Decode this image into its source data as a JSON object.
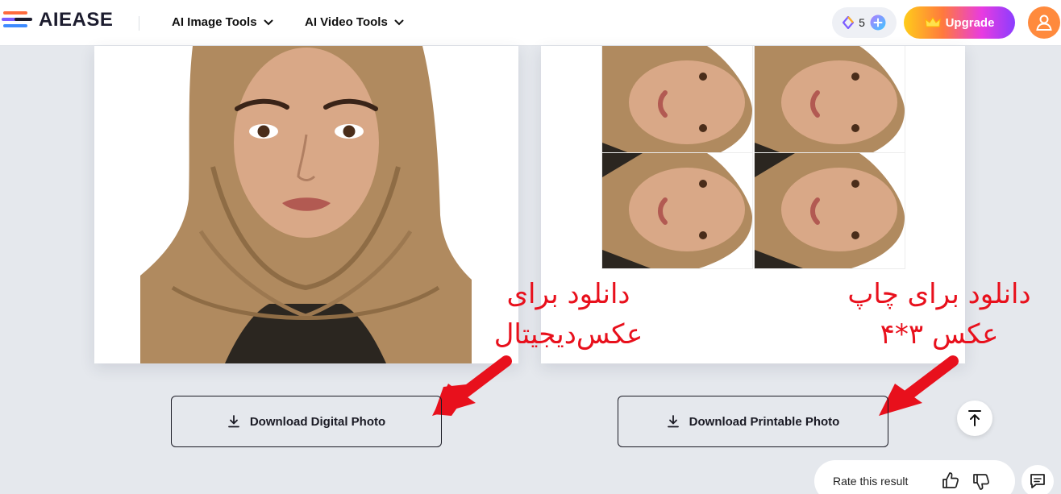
{
  "header": {
    "logo_text": "AIEASE",
    "nav": [
      {
        "label": "AI Image Tools"
      },
      {
        "label": "AI Video Tools"
      }
    ],
    "credits": "5",
    "upgrade_label": "Upgrade"
  },
  "annotations": {
    "left": {
      "line1": "دانلود برای",
      "line2": "عکس‌دیجیتال"
    },
    "right": {
      "line1": "دانلود برای چاپ",
      "line2": "عکس ۳*۴"
    }
  },
  "buttons": {
    "download_digital": "Download Digital Photo",
    "download_printable": "Download Printable Photo"
  },
  "rating": {
    "label": "Rate this result"
  },
  "colors": {
    "annotation": "#e8101c",
    "avatar": "#ff8a3d",
    "scarf": "#b08a5f",
    "page_bg": "#e5e8ed"
  }
}
